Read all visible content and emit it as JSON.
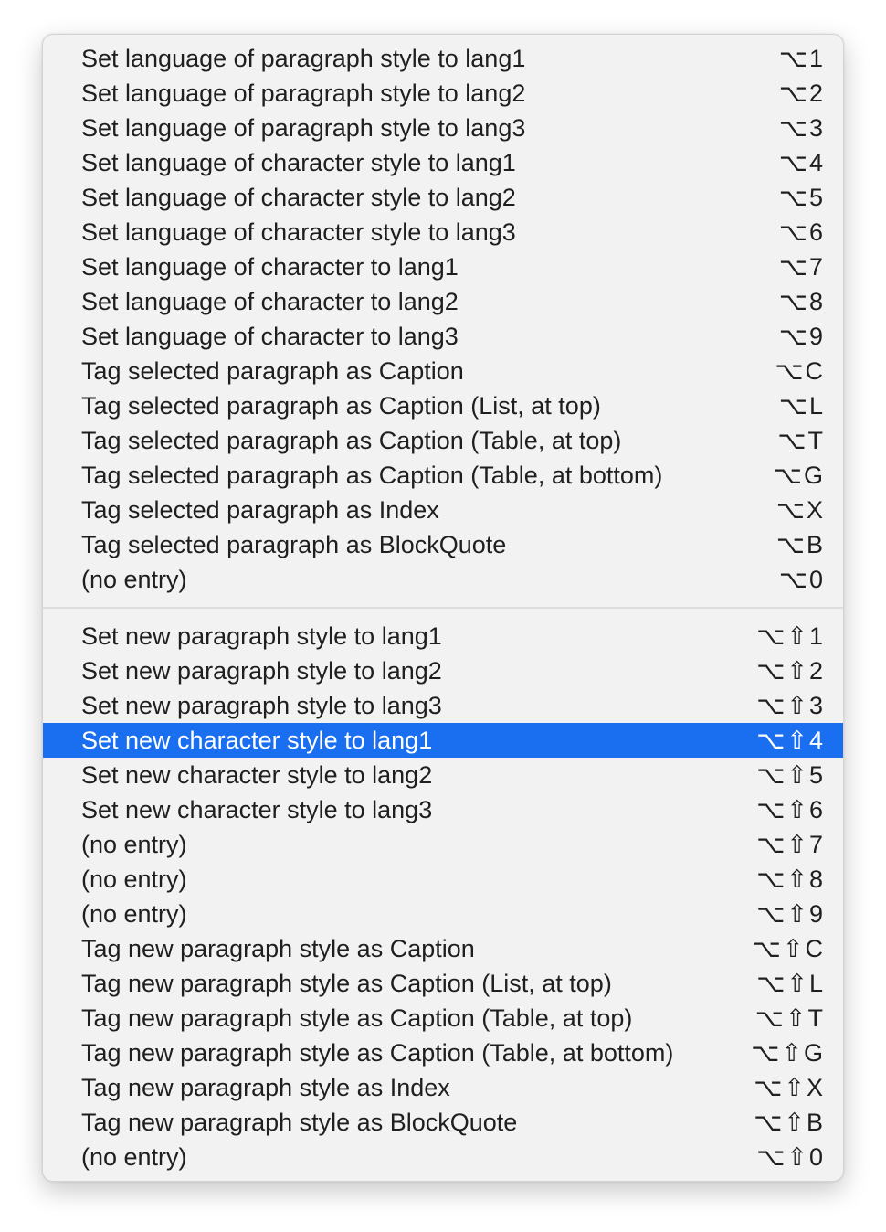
{
  "menu": {
    "group1": [
      {
        "label": "Set language of paragraph style to lang1",
        "shortcut": "⌥1"
      },
      {
        "label": "Set language of paragraph style to lang2",
        "shortcut": "⌥2"
      },
      {
        "label": "Set language of paragraph style to lang3",
        "shortcut": "⌥3"
      },
      {
        "label": "Set language of character style to lang1",
        "shortcut": "⌥4"
      },
      {
        "label": "Set language of character style to lang2",
        "shortcut": "⌥5"
      },
      {
        "label": "Set language of character style to lang3",
        "shortcut": "⌥6"
      },
      {
        "label": "Set language of character to lang1",
        "shortcut": "⌥7"
      },
      {
        "label": "Set language of character to lang2",
        "shortcut": "⌥8"
      },
      {
        "label": "Set language of character to lang3",
        "shortcut": "⌥9"
      },
      {
        "label": "Tag selected paragraph as Caption",
        "shortcut": "⌥C"
      },
      {
        "label": "Tag selected paragraph as Caption (List, at top)",
        "shortcut": "⌥L"
      },
      {
        "label": "Tag selected paragraph as Caption (Table, at top)",
        "shortcut": "⌥T"
      },
      {
        "label": "Tag selected paragraph as Caption (Table, at bottom)",
        "shortcut": "⌥G"
      },
      {
        "label": "Tag selected paragraph as Index",
        "shortcut": "⌥X"
      },
      {
        "label": "Tag selected paragraph as BlockQuote",
        "shortcut": "⌥B"
      },
      {
        "label": "(no entry)",
        "shortcut": "⌥0"
      }
    ],
    "group2": [
      {
        "label": "Set new paragraph style to lang1",
        "shortcut": "⌥⇧1"
      },
      {
        "label": "Set new paragraph style to lang2",
        "shortcut": "⌥⇧2"
      },
      {
        "label": "Set new paragraph style to lang3",
        "shortcut": "⌥⇧3"
      },
      {
        "label": "Set new character style to lang1",
        "shortcut": "⌥⇧4",
        "selected": true
      },
      {
        "label": "Set new character style to lang2",
        "shortcut": "⌥⇧5"
      },
      {
        "label": "Set new character style to lang3",
        "shortcut": "⌥⇧6"
      },
      {
        "label": "(no entry)",
        "shortcut": "⌥⇧7"
      },
      {
        "label": "(no entry)",
        "shortcut": "⌥⇧8"
      },
      {
        "label": "(no entry)",
        "shortcut": "⌥⇧9"
      },
      {
        "label": "Tag new paragraph style as Caption",
        "shortcut": "⌥⇧C"
      },
      {
        "label": "Tag new paragraph style as Caption (List, at top)",
        "shortcut": "⌥⇧L"
      },
      {
        "label": "Tag new paragraph style as Caption (Table, at top)",
        "shortcut": "⌥⇧T"
      },
      {
        "label": "Tag new paragraph style as Caption (Table, at bottom)",
        "shortcut": "⌥⇧G"
      },
      {
        "label": "Tag new paragraph style as Index",
        "shortcut": "⌥⇧X"
      },
      {
        "label": "Tag new paragraph style as BlockQuote",
        "shortcut": "⌥⇧B"
      },
      {
        "label": "(no entry)",
        "shortcut": "⌥⇧0"
      }
    ]
  },
  "colors": {
    "selected_bg": "#1a6ff0",
    "menu_bg": "#f2f2f2",
    "text": "#1f1f1f"
  }
}
